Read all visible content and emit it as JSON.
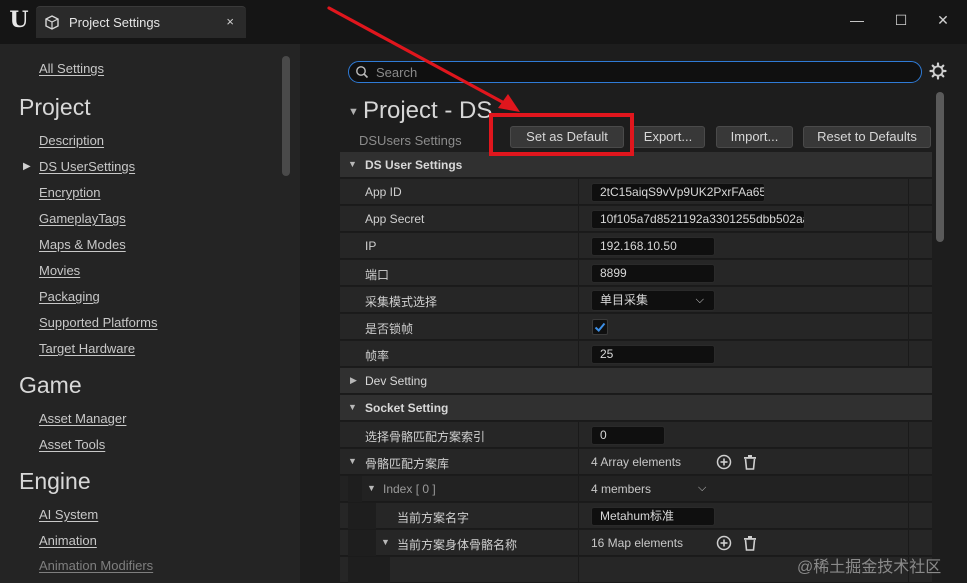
{
  "window": {
    "tab_title": "Project Settings",
    "close_glyph": "×",
    "controls": {
      "minimize": "—",
      "maximize": "☐",
      "close": "✕"
    }
  },
  "sidebar": {
    "all_settings": "All Settings",
    "sections": [
      {
        "title": "Project",
        "items": [
          "Description",
          "DS UserSettings",
          "Encryption",
          "GameplayTags",
          "Maps & Modes",
          "Movies",
          "Packaging",
          "Supported Platforms",
          "Target Hardware"
        ]
      },
      {
        "title": "Game",
        "items": [
          "Asset Manager",
          "Asset Tools"
        ]
      },
      {
        "title": "Engine",
        "items": [
          "AI System",
          "Animation",
          "Animation Modifiers"
        ]
      }
    ],
    "selected_item": "DS UserSettings"
  },
  "main": {
    "search_placeholder": "Search",
    "title": "Project - DS",
    "subtitle": "DSUsers Settings",
    "buttons": {
      "set_default": "Set as Default",
      "export": "Export...",
      "import": "Import...",
      "reset": "Reset to Defaults"
    },
    "categories": {
      "ds_user": "DS User Settings",
      "dev": "Dev Setting",
      "socket": "Socket Setting"
    },
    "props": {
      "app_id": {
        "label": "App ID",
        "value": "2tC15aiqS9vVp9UK2PxrFAa65"
      },
      "app_secret": {
        "label": "App Secret",
        "value": "10f105a7d8521192a3301255dbb502aa"
      },
      "ip": {
        "label": "IP",
        "value": "192.168.10.50"
      },
      "port": {
        "label": "端口",
        "value": "8899"
      },
      "mode": {
        "label": "采集模式选择",
        "value": "单目采集"
      },
      "lock_frame": {
        "label": "是否锁帧",
        "checked": true
      },
      "frame_rate": {
        "label": "帧率",
        "value": "25"
      },
      "skeleton_index": {
        "label": "选择骨骼匹配方案索引",
        "value": "0"
      },
      "skeleton_lib": {
        "label": "骨骼匹配方案库",
        "value": "4 Array elements"
      },
      "index0": {
        "label": "Index [ 0 ]",
        "value": "4 members"
      },
      "scheme_name": {
        "label": "当前方案名字",
        "value": "Metahum标准"
      },
      "bone_names": {
        "label": "当前方案身体骨骼名称",
        "value": "16 Map elements"
      }
    }
  },
  "watermark": "@稀土掘金技术社区",
  "colors": {
    "highlight": "#e0161d",
    "accent": "#2f7bd6"
  }
}
